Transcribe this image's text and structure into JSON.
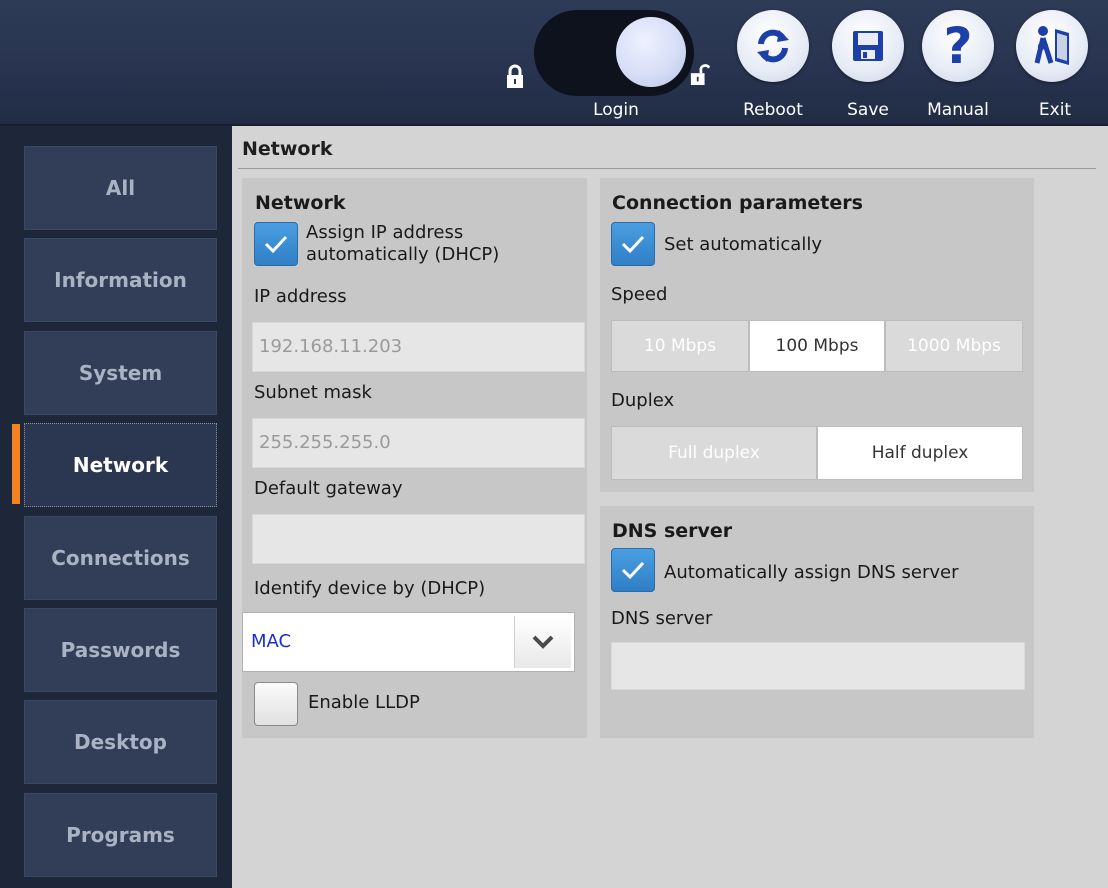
{
  "header": {
    "login": "Login",
    "reboot": "Reboot",
    "save": "Save",
    "manual": "Manual",
    "exit": "Exit",
    "manual_glyph": "?"
  },
  "sidebar": {
    "items": [
      {
        "label": "All"
      },
      {
        "label": "Information"
      },
      {
        "label": "System"
      },
      {
        "label": "Network"
      },
      {
        "label": "Connections"
      },
      {
        "label": "Passwords"
      },
      {
        "label": "Desktop"
      },
      {
        "label": "Programs"
      }
    ],
    "active": "Network"
  },
  "page": {
    "title": "Network"
  },
  "network": {
    "title": "Network",
    "dhcp_label": "Assign IP address automatically (DHCP)",
    "dhcp_checked": true,
    "ip_label": "IP address",
    "ip_value": "192.168.11.203",
    "subnet_label": "Subnet mask",
    "subnet_value": "255.255.255.0",
    "gateway_label": "Default gateway",
    "gateway_value": "",
    "identify_label": "Identify device by (DHCP)",
    "identify_value": "MAC",
    "lldp_label": "Enable LLDP",
    "lldp_checked": false
  },
  "connection": {
    "title": "Connection parameters",
    "auto_label": "Set automatically",
    "auto_checked": true,
    "speed_label": "Speed",
    "speed_options": [
      "10 Mbps",
      "100 Mbps",
      "1000 Mbps"
    ],
    "speed_selected": "100 Mbps",
    "duplex_label": "Duplex",
    "duplex_options": [
      "Full duplex",
      "Half duplex"
    ],
    "duplex_selected": "Half duplex"
  },
  "dns": {
    "title": "DNS server",
    "auto_label": "Automatically assign DNS server",
    "auto_checked": true,
    "server_label": "DNS server",
    "server_value": ""
  },
  "colors": {
    "active_marker": "#f58220",
    "checkbox_checked": "#3a8fd6",
    "select_value_text": "#1a2fd0"
  }
}
